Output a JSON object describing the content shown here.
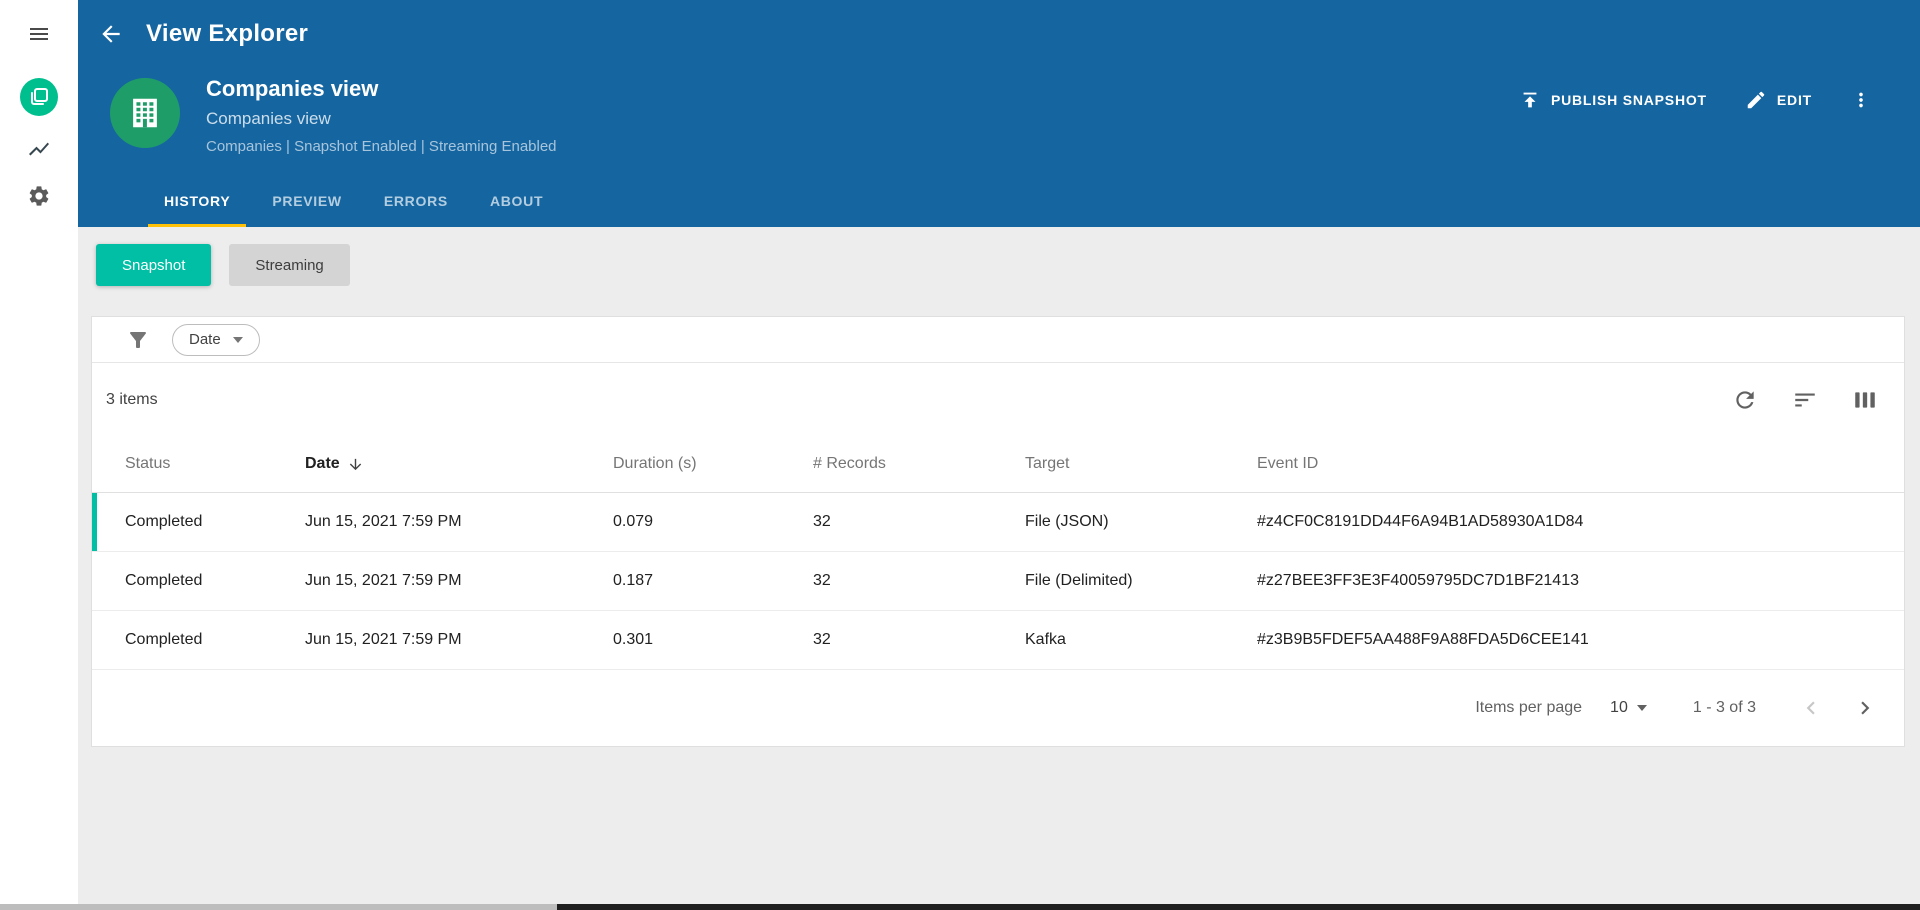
{
  "colors": {
    "header_blue": "#1565A0",
    "accent_teal": "#00BFA5",
    "tab_underline_amber": "#FFC107",
    "logo_circle_teal": "#00BF8F",
    "avatar_green": "#1F9D69",
    "content_background": "#EDEDED"
  },
  "app_bar": {
    "title": "View Explorer"
  },
  "sidebar": {
    "icons": [
      "hamburger-menu-icon",
      "views-logo-icon",
      "trend-chart-icon",
      "gear-icon"
    ]
  },
  "view_header": {
    "title": "Companies view",
    "subtitle": "Companies view",
    "meta": "Companies | Snapshot Enabled | Streaming Enabled",
    "actions": [
      {
        "label": "PUBLISH SNAPSHOT",
        "icon": "publish-icon"
      },
      {
        "label": "EDIT",
        "icon": "pencil-icon"
      },
      {
        "label": "",
        "icon": "kebab-menu-icon"
      }
    ]
  },
  "tabs": [
    {
      "label": "HISTORY",
      "active": true
    },
    {
      "label": "PREVIEW",
      "active": false
    },
    {
      "label": "ERRORS",
      "active": false
    },
    {
      "label": "ABOUT",
      "active": false
    }
  ],
  "mode_toggle": {
    "snapshot": "Snapshot",
    "streaming": "Streaming",
    "selected": "Snapshot"
  },
  "filter_bar": {
    "filter_field": "Date"
  },
  "results": {
    "count_label": "3 items",
    "columns": [
      "Status",
      "Date",
      "Duration (s)",
      "# Records",
      "Target",
      "Event ID"
    ],
    "sorted_column": "Date",
    "sort_direction": "desc",
    "rows": [
      {
        "status": "Completed",
        "date": "Jun 15, 2021 7:59 PM",
        "duration": "0.079",
        "records": "32",
        "target": "File (JSON)",
        "event_id": "#z4CF0C8191DD44F6A94B1AD58930A1D84"
      },
      {
        "status": "Completed",
        "date": "Jun 15, 2021 7:59 PM",
        "duration": "0.187",
        "records": "32",
        "target": "File (Delimited)",
        "event_id": "#z27BEE3FF3E3F40059795DC7D1BF21413"
      },
      {
        "status": "Completed",
        "date": "Jun 15, 2021 7:59 PM",
        "duration": "0.301",
        "records": "32",
        "target": "Kafka",
        "event_id": "#z3B9B5FDEF5AA488F9A88FDA5D6CEE141"
      }
    ]
  },
  "pagination": {
    "items_per_page_label": "Items per page",
    "page_size": "10",
    "range_label": "1 - 3 of 3"
  }
}
